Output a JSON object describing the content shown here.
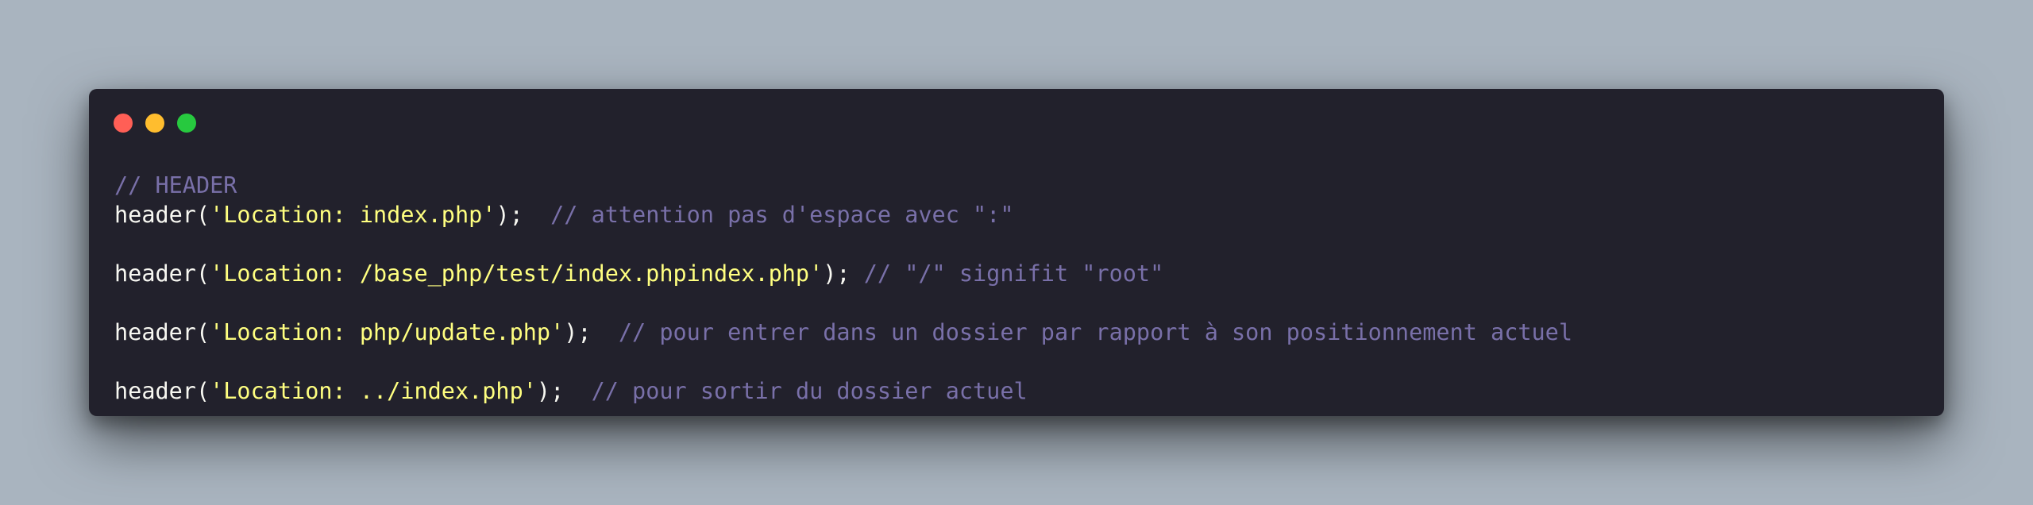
{
  "window": {
    "controls": {
      "close_color": "#ff5f56",
      "minimize_color": "#ffbd2e",
      "maximize_color": "#27c93f"
    }
  },
  "code": {
    "theme": {
      "background": "#22212c",
      "text": "#f8f8f2",
      "string": "#ffff80",
      "comment": "#7970a9"
    },
    "lines": [
      {
        "comment": "// HEADER"
      },
      {
        "fn": "header(",
        "str": "'Location: index.php'",
        "close": ");",
        "gap": "  ",
        "comment": "// attention pas d'espace avec \":\""
      },
      {},
      {
        "fn": "header(",
        "str": "'Location: /base_php/test/index.phpindex.php'",
        "close": ");",
        "gap": " ",
        "comment": "// \"/\" signifit \"root\""
      },
      {},
      {
        "fn": "header(",
        "str": "'Location: php/update.php'",
        "close": ");",
        "gap": "  ",
        "comment": "// pour entrer dans un dossier par rapport à son positionnement actuel"
      },
      {},
      {
        "fn": "header(",
        "str": "'Location: ../index.php'",
        "close": ");",
        "gap": "  ",
        "comment": "// pour sortir du dossier actuel"
      }
    ]
  }
}
